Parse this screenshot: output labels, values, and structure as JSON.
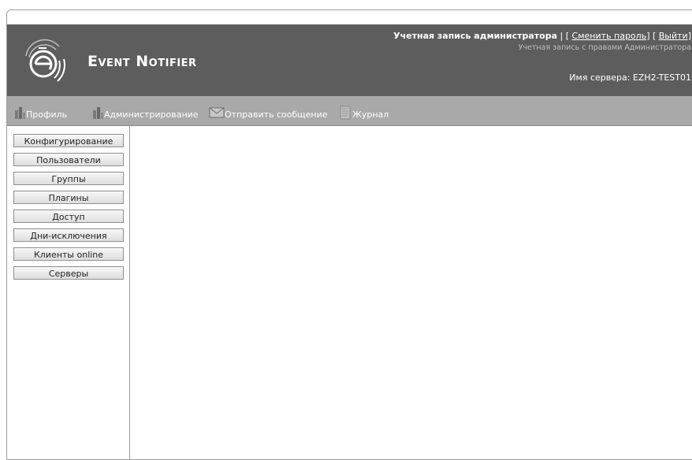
{
  "header": {
    "brand": "Event Notifier",
    "logo_letter": "e",
    "account_label": "Учетная запись администратора",
    "account_sep1": " | [ ",
    "change_password": "Сменить пароль",
    "account_sep2": "] [ ",
    "logout": "Выйти",
    "account_sep3": "]",
    "rights": "Учетная запись с правами Администратора",
    "server": "Имя сервера: EZH2-TEST01"
  },
  "nav": {
    "items": [
      {
        "label": "Профиль",
        "icon": "profile-icon"
      },
      {
        "label": "Администрирование",
        "icon": "admin-icon"
      },
      {
        "label": "Отправить сообщение",
        "icon": "envelope-icon"
      },
      {
        "label": "Журнал",
        "icon": "journal-icon"
      }
    ]
  },
  "sidebar": {
    "items": [
      {
        "label": "Конфигурирование"
      },
      {
        "label": "Пользователи"
      },
      {
        "label": "Группы"
      },
      {
        "label": "Плагины"
      },
      {
        "label": "Доступ"
      },
      {
        "label": "Дни-исключения"
      },
      {
        "label": "Клиенты online"
      },
      {
        "label": "Серверы"
      }
    ]
  },
  "colors": {
    "header_bg": "#5d5d5d",
    "navbar_bg": "#a9a9a9",
    "rights_text": "#bdbdbd"
  }
}
